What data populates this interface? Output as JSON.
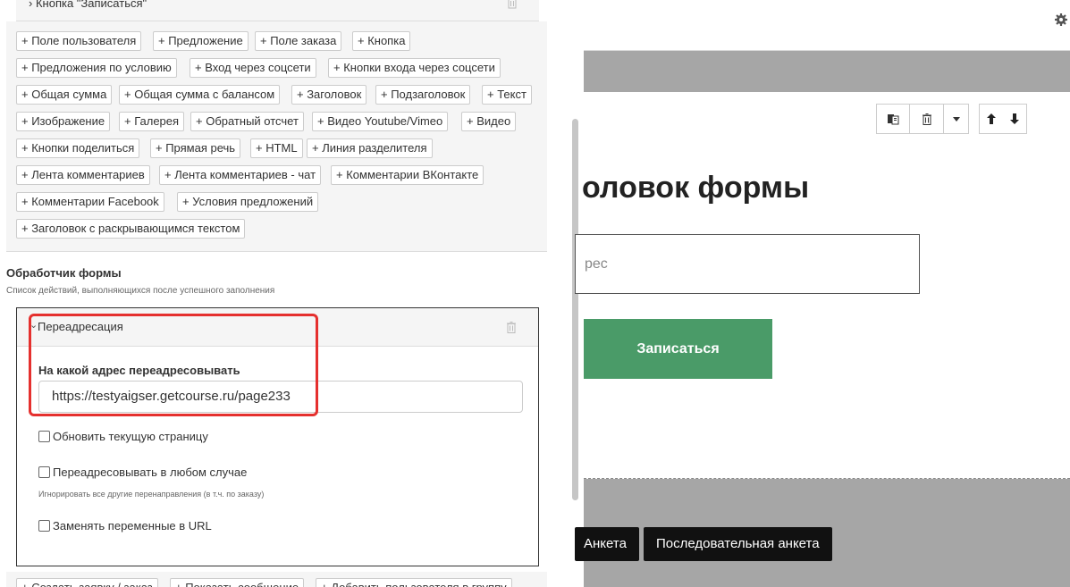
{
  "top_block": {
    "label": "Кнопка \"Записаться\"",
    "chevron": "›"
  },
  "add_buttons": [
    "+ Поле пользователя",
    "+ Предложение",
    "+ Поле заказа",
    "+ Кнопка",
    "+ Предложения по условию",
    "+ Вход через соцсети",
    "+ Кнопки входа через соцсети",
    "+ Общая сумма",
    "+ Общая сумма с балансом",
    "+ Заголовок",
    "+ Подзаголовок",
    "+ Текст",
    "+ Изображение",
    "+ Галерея",
    "+ Обратный отсчет",
    "+ Видео Youtube/Vimeo",
    "+ Видео",
    "+ Кнопки поделиться",
    "+ Прямая речь",
    "+ HTML",
    "+ Линия разделителя",
    "+ Лента комментариев",
    "+ Лента комментариев - чат",
    "+ Комментарии ВКонтакте",
    "+ Комментарии Facebook",
    "+ Условия предложений",
    "+ Заголовок с раскрывающимся текстом"
  ],
  "handler": {
    "title": "Обработчик формы",
    "description": "Список действий, выполняющихся после успешного заполнения"
  },
  "redirect": {
    "header_label": "Переадресация",
    "chevron": "⌄",
    "field_label": "На какой адрес переадресовывать",
    "url_value": "https://testyaigser.getcourse.ru/page233",
    "checkbox_refresh": "Обновить текущую страницу",
    "checkbox_always": "Переадресовывать в любом случае",
    "checkbox_always_hint": "Игнорировать все другие перенаправления (в т.ч. по заказу)",
    "checkbox_replace_vars": "Заменять переменные в URL"
  },
  "bottom_buttons": [
    "+ Создать заявку / заказ",
    "+ Показать сообщение",
    "+ Добавить пользователя в группу"
  ],
  "preview": {
    "form_title": "оловок формы",
    "input_placeholder": "рес",
    "submit_label": "Записаться"
  },
  "variant_tabs": [
    "Анкета",
    "Последовательная анкета"
  ],
  "colors": {
    "highlight": "#e5302e",
    "submit_bg": "#4a9b68",
    "preview_bg": "#a6a6a6"
  },
  "icons": [
    "trash-icon",
    "copy-icon",
    "caret-down-icon",
    "arrow-up-icon",
    "arrow-down-icon",
    "gear-icon"
  ]
}
